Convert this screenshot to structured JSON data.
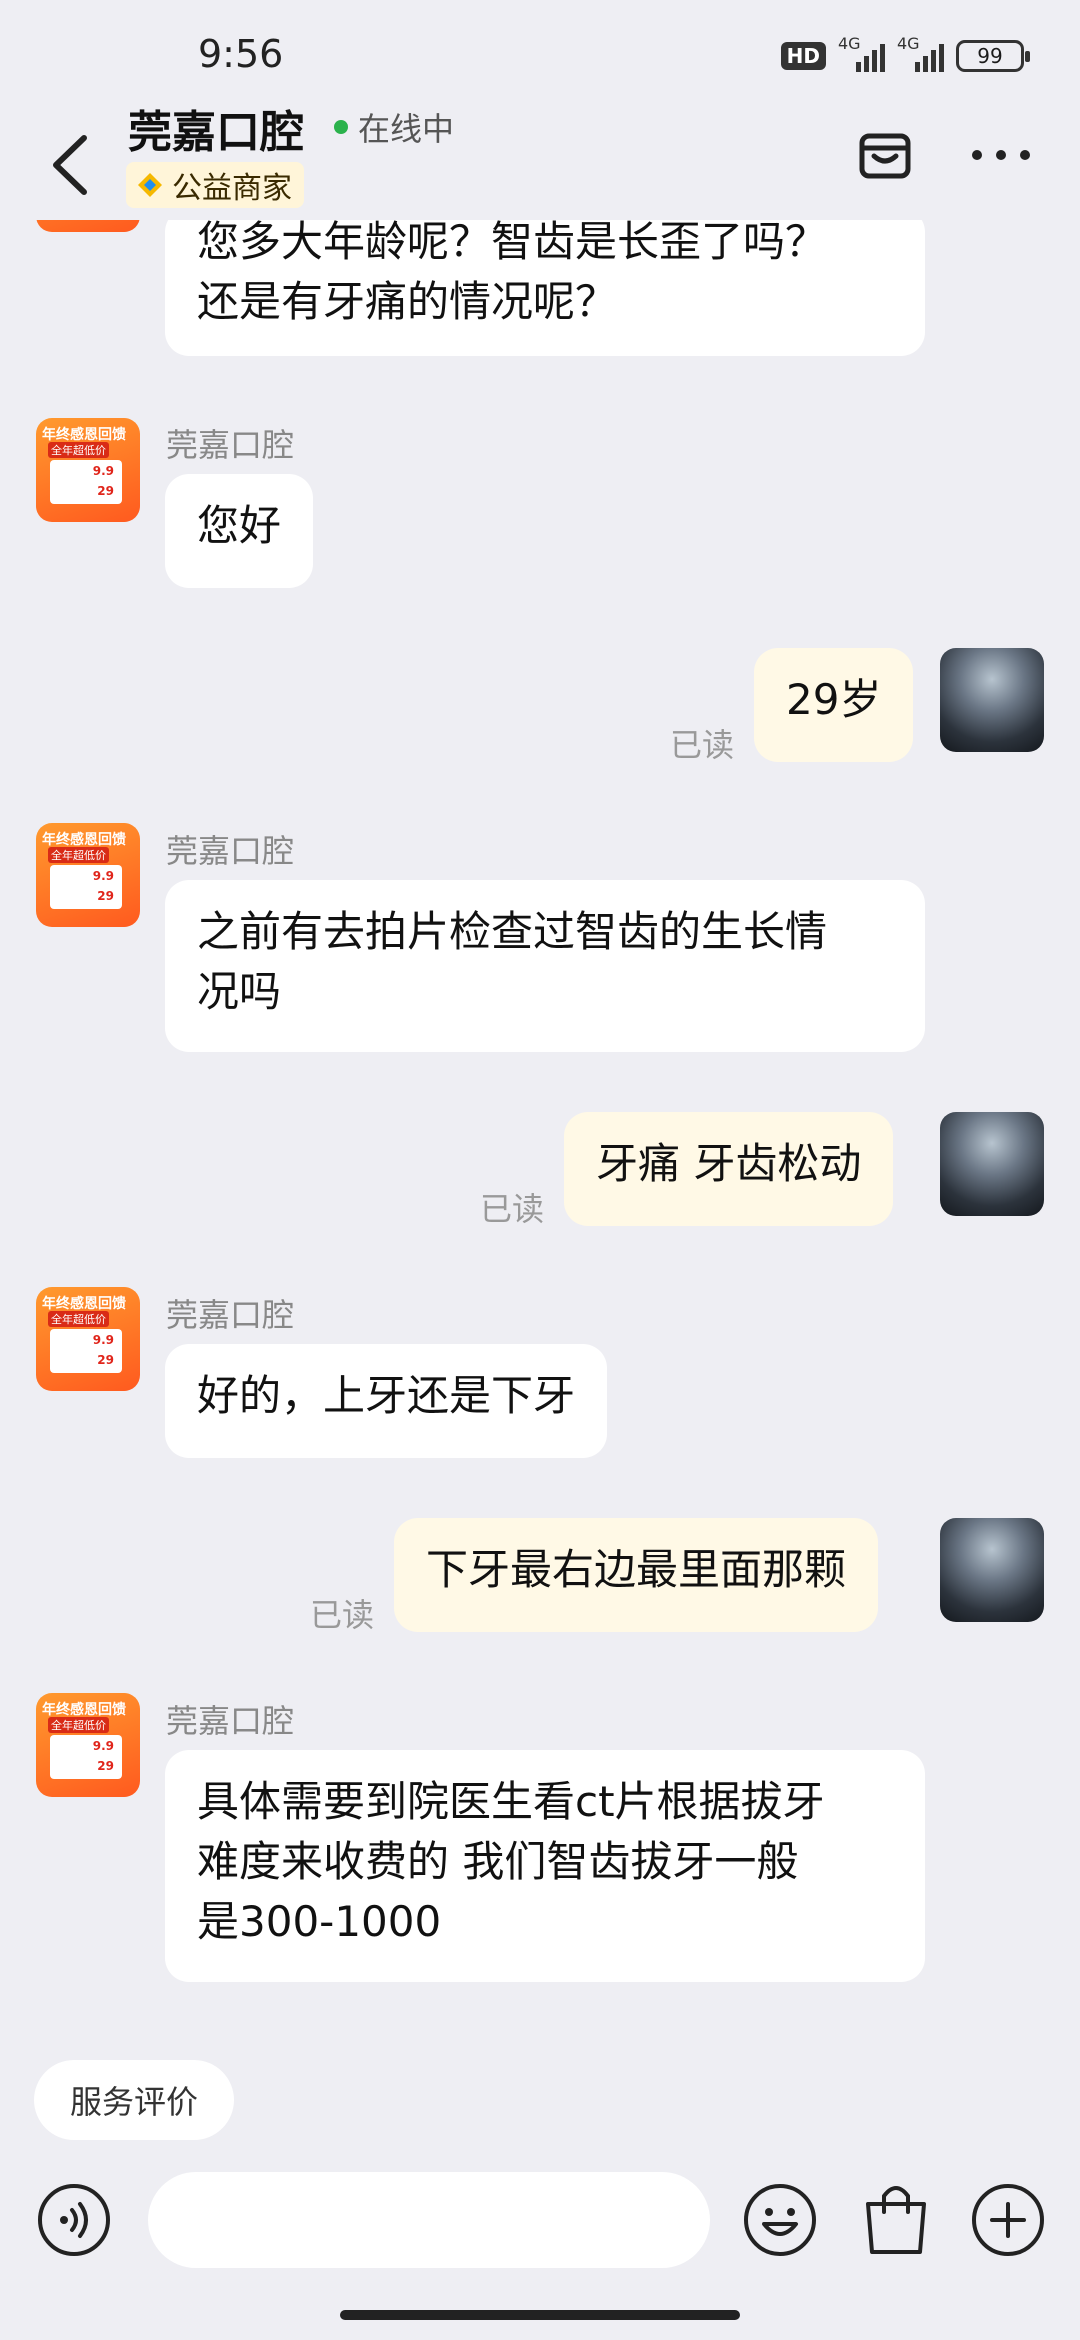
{
  "status_bar": {
    "time": "9:56",
    "hd_label": "HD",
    "net1": "4G",
    "net2": "4G",
    "battery": "99"
  },
  "header": {
    "title": "莞嘉口腔",
    "online_status": "在线中",
    "badge_label": "公益商家"
  },
  "shop_avatar": {
    "line1": "年终感恩回馈",
    "line2": "全年超低价",
    "price1": "9.9",
    "price2": "29"
  },
  "messages": [
    {
      "from": "shop",
      "sender": "",
      "lines": [
        "您多大年龄呢？智齿是长歪了吗？",
        "还是有牙痛的情况呢？"
      ]
    },
    {
      "from": "shop",
      "sender": "莞嘉口腔",
      "lines": [
        "您好"
      ]
    },
    {
      "from": "me",
      "status": "已读",
      "lines": [
        "29岁"
      ]
    },
    {
      "from": "shop",
      "sender": "莞嘉口腔",
      "lines": [
        "之前有去拍片检查过智齿的生长情",
        "况吗"
      ]
    },
    {
      "from": "me",
      "status": "已读",
      "lines": [
        "牙痛 牙齿松动"
      ]
    },
    {
      "from": "shop",
      "sender": "莞嘉口腔",
      "lines": [
        "好的，上牙还是下牙"
      ]
    },
    {
      "from": "me",
      "status": "已读",
      "lines": [
        "下牙最右边最里面那颗"
      ]
    },
    {
      "from": "shop",
      "sender": "莞嘉口腔",
      "lines": [
        "具体需要到院医生看ct片根据拔牙",
        "难度来收费的 我们智齿拔牙一般",
        "是300-1000"
      ]
    }
  ],
  "service_rating_label": "服务评价",
  "input": {
    "placeholder": ""
  },
  "colors": {
    "online_dot": "#2bb24c",
    "my_bubble": "#fff9e6",
    "shop_avatar": "#ff6a1f"
  }
}
